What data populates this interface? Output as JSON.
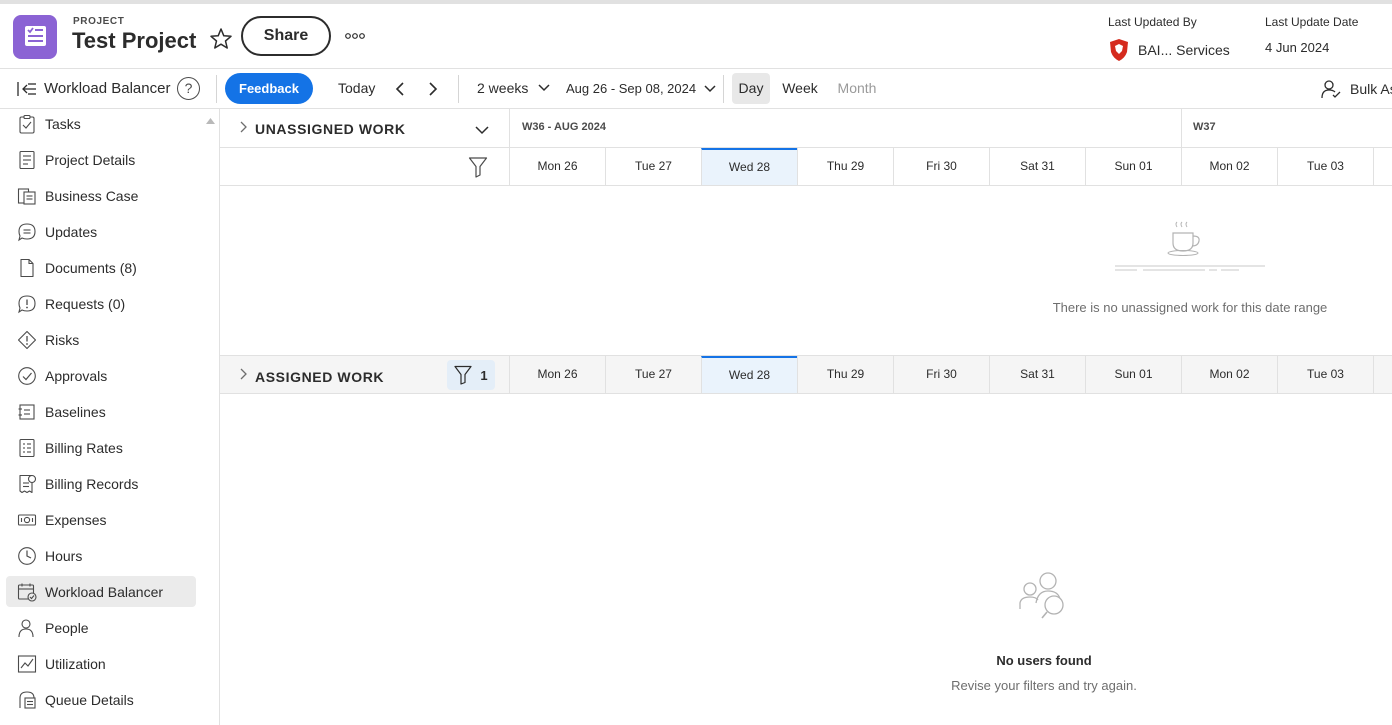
{
  "header": {
    "eyebrow": "PROJECT",
    "title": "Test Project",
    "share_label": "Share",
    "more_icon": "more-horizontal-icon",
    "last_updated_by_label": "Last Updated By",
    "last_updated_by_value": "BAI... Services",
    "last_update_date_label": "Last Update Date",
    "last_update_date_value": "4 Jun 2024",
    "brand_color": "#8b63d4",
    "avatar_color": "#d52b1e"
  },
  "toolbar": {
    "title": "Workload Balancer",
    "help_label": "?",
    "feedback_label": "Feedback",
    "today_label": "Today",
    "range_label": "2 weeks",
    "dates_label": "Aug 26 - Sep 08, 2024",
    "views": [
      "Day",
      "Week",
      "Month"
    ],
    "active_view": "Day",
    "bulk_label": "Bulk As",
    "accent_color": "#1473e6"
  },
  "sidebar": {
    "items": [
      {
        "label": "Tasks",
        "icon": "tasks-icon"
      },
      {
        "label": "Project Details",
        "icon": "document-icon"
      },
      {
        "label": "Business Case",
        "icon": "business-case-icon"
      },
      {
        "label": "Updates",
        "icon": "chat-bubble-icon"
      },
      {
        "label": "Documents (8)",
        "icon": "file-icon"
      },
      {
        "label": "Requests (0)",
        "icon": "request-icon"
      },
      {
        "label": "Risks",
        "icon": "risk-diamond-icon"
      },
      {
        "label": "Approvals",
        "icon": "check-circle-icon"
      },
      {
        "label": "Baselines",
        "icon": "baseline-icon"
      },
      {
        "label": "Billing Rates",
        "icon": "billing-rates-icon"
      },
      {
        "label": "Billing Records",
        "icon": "billing-records-icon"
      },
      {
        "label": "Expenses",
        "icon": "money-icon"
      },
      {
        "label": "Hours",
        "icon": "clock-icon"
      },
      {
        "label": "Workload Balancer",
        "icon": "calendar-check-icon"
      },
      {
        "label": "People",
        "icon": "people-icon"
      },
      {
        "label": "Utilization",
        "icon": "line-chart-icon"
      },
      {
        "label": "Queue Details",
        "icon": "queue-icon"
      }
    ],
    "active_index": 13
  },
  "timeline": {
    "weeks": [
      "W36 - AUG 2024",
      "W37"
    ],
    "days": [
      "Mon 26",
      "Tue 27",
      "Wed 28",
      "Thu 29",
      "Fri 30",
      "Sat 31",
      "Sun 01",
      "Mon 02",
      "Tue 03"
    ],
    "today_index": 2
  },
  "unassigned": {
    "title": "UNASSIGNED WORK",
    "empty_message": "There is no unassigned work for this date range"
  },
  "assigned": {
    "title": "ASSIGNED WORK",
    "filter_count": "1",
    "empty_title": "No users found",
    "empty_message": "Revise your filters and try again."
  }
}
